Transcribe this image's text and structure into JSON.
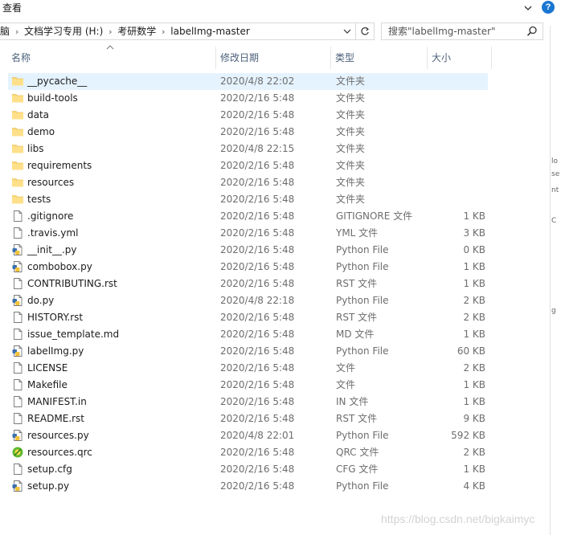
{
  "ribbon": {
    "view_tab": "查看"
  },
  "address_bar": {
    "breadcrumbs": [
      "脑",
      "文档学习专用 (H:)",
      "考研数学",
      "labelImg-master"
    ]
  },
  "search": {
    "placeholder": "搜索\"labelImg-master\""
  },
  "columns": {
    "name": "名称",
    "date": "修改日期",
    "type": "类型",
    "size": "大小"
  },
  "files": [
    {
      "name": "__pycache__",
      "date": "2020/4/8 22:02",
      "type": "文件夹",
      "size": "",
      "icon": "folder-icon",
      "selected": true
    },
    {
      "name": "build-tools",
      "date": "2020/2/16 5:48",
      "type": "文件夹",
      "size": "",
      "icon": "folder-icon"
    },
    {
      "name": "data",
      "date": "2020/2/16 5:48",
      "type": "文件夹",
      "size": "",
      "icon": "folder-icon"
    },
    {
      "name": "demo",
      "date": "2020/2/16 5:48",
      "type": "文件夹",
      "size": "",
      "icon": "folder-icon"
    },
    {
      "name": "libs",
      "date": "2020/4/8 22:15",
      "type": "文件夹",
      "size": "",
      "icon": "folder-icon"
    },
    {
      "name": "requirements",
      "date": "2020/2/16 5:48",
      "type": "文件夹",
      "size": "",
      "icon": "folder-icon"
    },
    {
      "name": "resources",
      "date": "2020/2/16 5:48",
      "type": "文件夹",
      "size": "",
      "icon": "folder-icon"
    },
    {
      "name": "tests",
      "date": "2020/2/16 5:48",
      "type": "文件夹",
      "size": "",
      "icon": "folder-icon"
    },
    {
      "name": ".gitignore",
      "date": "2020/2/16 5:48",
      "type": "GITIGNORE 文件",
      "size": "1 KB",
      "icon": "document-icon"
    },
    {
      "name": ".travis.yml",
      "date": "2020/2/16 5:48",
      "type": "YML 文件",
      "size": "3 KB",
      "icon": "document-icon"
    },
    {
      "name": "__init__.py",
      "date": "2020/2/16 5:48",
      "type": "Python File",
      "size": "0 KB",
      "icon": "python-file-icon"
    },
    {
      "name": "combobox.py",
      "date": "2020/2/16 5:48",
      "type": "Python File",
      "size": "1 KB",
      "icon": "python-file-icon"
    },
    {
      "name": "CONTRIBUTING.rst",
      "date": "2020/2/16 5:48",
      "type": "RST 文件",
      "size": "1 KB",
      "icon": "document-icon"
    },
    {
      "name": "do.py",
      "date": "2020/4/8 22:18",
      "type": "Python File",
      "size": "2 KB",
      "icon": "python-file-icon"
    },
    {
      "name": "HISTORY.rst",
      "date": "2020/2/16 5:48",
      "type": "RST 文件",
      "size": "2 KB",
      "icon": "document-icon"
    },
    {
      "name": "issue_template.md",
      "date": "2020/2/16 5:48",
      "type": "MD 文件",
      "size": "1 KB",
      "icon": "document-icon"
    },
    {
      "name": "labelImg.py",
      "date": "2020/2/16 5:48",
      "type": "Python File",
      "size": "60 KB",
      "icon": "python-file-icon"
    },
    {
      "name": "LICENSE",
      "date": "2020/2/16 5:48",
      "type": "文件",
      "size": "2 KB",
      "icon": "document-icon"
    },
    {
      "name": "Makefile",
      "date": "2020/2/16 5:48",
      "type": "文件",
      "size": "1 KB",
      "icon": "document-icon"
    },
    {
      "name": "MANIFEST.in",
      "date": "2020/2/16 5:48",
      "type": "IN 文件",
      "size": "1 KB",
      "icon": "document-icon"
    },
    {
      "name": "README.rst",
      "date": "2020/2/16 5:48",
      "type": "RST 文件",
      "size": "9 KB",
      "icon": "document-icon"
    },
    {
      "name": "resources.py",
      "date": "2020/4/8 22:01",
      "type": "Python File",
      "size": "592 KB",
      "icon": "python-file-icon"
    },
    {
      "name": "resources.qrc",
      "date": "2020/2/16 5:48",
      "type": "QRC 文件",
      "size": "2 KB",
      "icon": "qrc-file-icon"
    },
    {
      "name": "setup.cfg",
      "date": "2020/2/16 5:48",
      "type": "CFG 文件",
      "size": "1 KB",
      "icon": "document-icon"
    },
    {
      "name": "setup.py",
      "date": "2020/2/16 5:48",
      "type": "Python File",
      "size": "4 KB",
      "icon": "python-file-icon"
    }
  ],
  "right_edge_fragments": [
    "lo",
    "se",
    "nt",
    "C",
    "g"
  ],
  "watermark": "https://blog.csdn.net/bigkaimyc",
  "colors": {
    "selection": "#e5f3ff",
    "folder": "#f8d775",
    "header_text": "#4c607a",
    "secondary_text": "#6d6d6d"
  }
}
